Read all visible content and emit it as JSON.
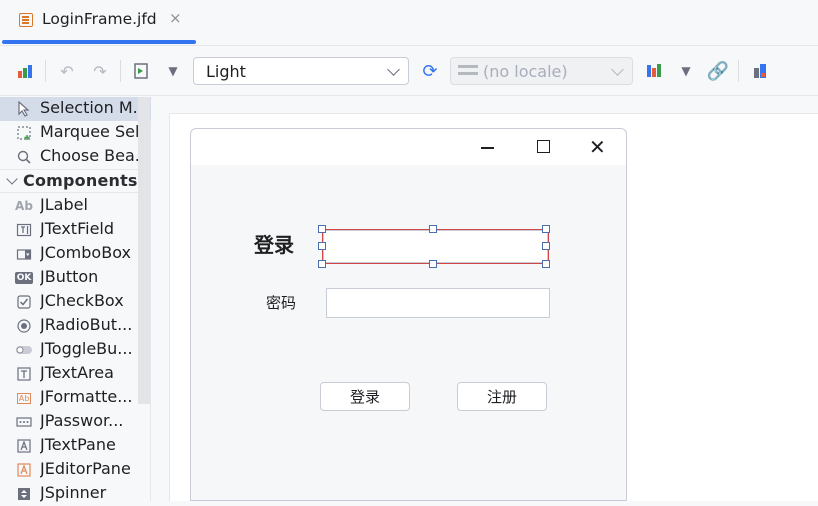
{
  "editor": {
    "tab_title": "LoginFrame.jfd",
    "tab_close": "×"
  },
  "toolbar": {
    "theme_value": "Light",
    "locale_value": "(no locale)"
  },
  "palette": {
    "tools": [
      {
        "label": "Selection M...",
        "icon": "cursor-arrow-icon"
      },
      {
        "label": "Marquee Sel...",
        "icon": "marquee-select-icon"
      },
      {
        "label": "Choose Bea...",
        "icon": "magnifier-icon"
      }
    ],
    "group_label": "Components",
    "components": [
      {
        "label": "JLabel",
        "icon": "jlabel-icon"
      },
      {
        "label": "JTextField",
        "icon": "jtextfield-icon"
      },
      {
        "label": "JComboBox",
        "icon": "jcombobox-icon"
      },
      {
        "label": "JButton",
        "icon": "jbutton-icon"
      },
      {
        "label": "JCheckBox",
        "icon": "jcheckbox-icon"
      },
      {
        "label": "JRadioBut...",
        "icon": "jradiobutton-icon"
      },
      {
        "label": "JToggleBu...",
        "icon": "jtogglebutton-icon"
      },
      {
        "label": "JTextArea",
        "icon": "jtextarea-icon"
      },
      {
        "label": "JFormatte...",
        "icon": "jformattedtextfield-icon"
      },
      {
        "label": "JPasswor...",
        "icon": "jpasswordfield-icon"
      },
      {
        "label": "JTextPane",
        "icon": "jtextpane-icon"
      },
      {
        "label": "JEditorPane",
        "icon": "jeditorpane-icon"
      },
      {
        "label": "JSpinner",
        "icon": "jspinner-icon"
      }
    ]
  },
  "frame": {
    "login_label": "登录",
    "password_label": "密码",
    "login_button": "登录",
    "register_button": "注册"
  },
  "colors": {
    "accent": "#3574f0",
    "selection_border": "#d04545",
    "handle_border": "#4b6eaf"
  }
}
